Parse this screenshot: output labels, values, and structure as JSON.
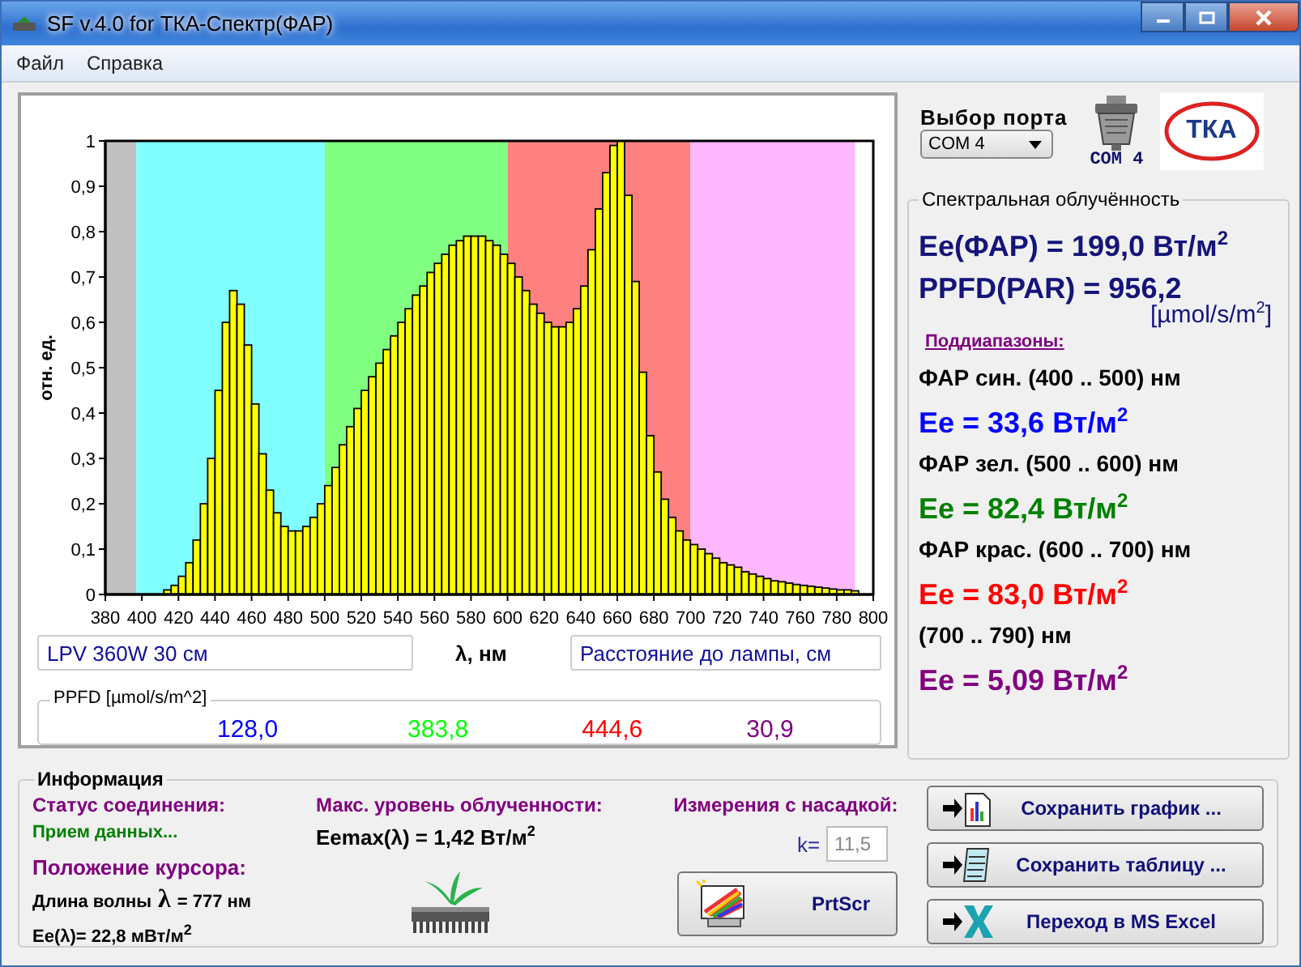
{
  "window": {
    "title": "SF v.4.0 for ТКА-Спектр(ФАР)"
  },
  "menu": [
    "Файл",
    "Справка"
  ],
  "chart": {
    "chart_data": {
      "type": "bar",
      "ylabel": "отн. ед.",
      "xlabel": "λ, нм",
      "x": [
        402,
        406,
        410,
        414,
        418,
        422,
        426,
        430,
        434,
        438,
        442,
        446,
        450,
        454,
        458,
        462,
        466,
        470,
        474,
        478,
        482,
        486,
        490,
        494,
        498,
        502,
        506,
        510,
        514,
        518,
        522,
        526,
        530,
        534,
        538,
        542,
        546,
        550,
        554,
        558,
        562,
        566,
        570,
        574,
        578,
        582,
        586,
        590,
        594,
        598,
        602,
        606,
        610,
        614,
        618,
        622,
        626,
        630,
        634,
        638,
        642,
        646,
        650,
        654,
        658,
        662,
        666,
        670,
        674,
        678,
        682,
        686,
        690,
        694,
        698,
        702,
        706,
        710,
        714,
        718,
        722,
        726,
        730,
        734,
        738,
        742,
        746,
        750,
        754,
        758,
        762,
        766,
        770,
        774,
        778,
        782,
        786,
        790
      ],
      "values": [
        0.0,
        0.0,
        0.0,
        0.01,
        0.02,
        0.04,
        0.07,
        0.12,
        0.2,
        0.3,
        0.45,
        0.6,
        0.67,
        0.64,
        0.55,
        0.42,
        0.31,
        0.23,
        0.18,
        0.15,
        0.14,
        0.14,
        0.15,
        0.17,
        0.2,
        0.24,
        0.28,
        0.33,
        0.37,
        0.41,
        0.45,
        0.48,
        0.51,
        0.54,
        0.57,
        0.6,
        0.63,
        0.66,
        0.68,
        0.71,
        0.73,
        0.75,
        0.77,
        0.78,
        0.79,
        0.79,
        0.79,
        0.78,
        0.77,
        0.75,
        0.73,
        0.7,
        0.67,
        0.64,
        0.62,
        0.6,
        0.59,
        0.59,
        0.6,
        0.63,
        0.68,
        0.76,
        0.85,
        0.93,
        0.99,
        1.0,
        0.88,
        0.69,
        0.49,
        0.35,
        0.27,
        0.21,
        0.17,
        0.14,
        0.12,
        0.11,
        0.1,
        0.09,
        0.08,
        0.07,
        0.065,
        0.06,
        0.05,
        0.045,
        0.04,
        0.035,
        0.03,
        0.028,
        0.025,
        0.022,
        0.02,
        0.018,
        0.016,
        0.014,
        0.012,
        0.01,
        0.01,
        0.008
      ],
      "xlim": [
        380,
        800
      ],
      "ylim": [
        0,
        1
      ],
      "xticks": [
        380,
        400,
        420,
        440,
        460,
        480,
        500,
        520,
        540,
        560,
        580,
        600,
        620,
        640,
        660,
        680,
        700,
        720,
        740,
        760,
        780,
        800
      ],
      "yticks": [
        0,
        {
          "value": 0.1,
          "label": "0,1"
        },
        {
          "value": 0.2,
          "label": "0,2"
        },
        {
          "value": 0.3,
          "label": "0,3"
        },
        {
          "value": 0.4,
          "label": "0,4"
        },
        {
          "value": 0.5,
          "label": "0,5"
        },
        {
          "value": 0.6,
          "label": "0,6"
        },
        {
          "value": 0.7,
          "label": "0,7"
        },
        {
          "value": 0.8,
          "label": "0,8"
        },
        {
          "value": 0.9,
          "label": "0,9"
        },
        1
      ],
      "bands": [
        {
          "axis": "x",
          "from": 380,
          "to": 397,
          "color": "#c0c0c0"
        },
        {
          "axis": "x",
          "from": 397,
          "to": 500,
          "color": "#80ffff"
        },
        {
          "axis": "x",
          "from": 500,
          "to": 600,
          "color": "#80ff80"
        },
        {
          "axis": "x",
          "from": 600,
          "to": 700,
          "color": "#ff8080"
        },
        {
          "axis": "x",
          "from": 700,
          "to": 790,
          "color": "#ffb8ff"
        }
      ]
    },
    "fields": [
      {
        "value": "LPV 360W 30 см"
      },
      {
        "value": "Расстояние до лампы,  см"
      }
    ],
    "ppfd": {
      "title": "PPFD [µmol/s/m^2]",
      "values": [
        {
          "text": "128,0",
          "color": "#0000ff"
        },
        {
          "text": "383,8",
          "color": "#00ff00"
        },
        {
          "text": "444,6",
          "color": "#ff0000"
        },
        {
          "text": "30,9",
          "color": "#800080"
        }
      ]
    }
  },
  "port": {
    "label": "Выбор порта",
    "selected": "COM 4",
    "status": "COM 4"
  },
  "logo": {
    "text": "ТКА"
  },
  "spectral": {
    "title": "Спектральная облучённость",
    "total": "Ee(ФАР) = 199,0 Вт/м$^{2}$",
    "ppfd": "PPFD(PAR) = 956,2",
    "ppfd_unit": "[µmol/s/m$^{2}$]",
    "subranges_title": "Поддиапазоны:",
    "bands": [
      {
        "label": "ФАР син. (400 .. 500) нм",
        "value": "Ee = 33,6 Вт/м$^{2}$",
        "color": "#0000ff"
      },
      {
        "label": "ФАР зел. (500 .. 600) нм",
        "value": "Ee = 82,4 Вт/м$^{2}$",
        "color": "#008000"
      },
      {
        "label": "ФАР крас. (600 .. 700) нм",
        "value": "Ee = 83,0 Вт/м$^{2}$",
        "color": "#ff0000"
      },
      {
        "label": "(700 .. 790) нм",
        "value": "Ee = 5,09 Вт/м$^{2}$",
        "color": "#800080"
      }
    ]
  },
  "info": {
    "title": "Информация",
    "status_label": "Статус соединения:",
    "status_value": "Прием данных...",
    "cursor_label": "Положение курсора:",
    "wavelength_label": "Длина волны",
    "wavelength_symbol": "λ",
    "wavelength_value": "= 777 нм",
    "cursor_ee": "Ee(λ)= 22,8 мВт/м$^{2}$",
    "max_label": "Макс. уровень облученности:",
    "max_value": "Eemax(λ) = 1,42 Вт/м$^{2}$",
    "nozzle_label": "Измерения с насадкой:",
    "k_label": "k=",
    "k_value": "11,5",
    "prtscr": "PrtScr"
  },
  "buttons": [
    {
      "label": "Сохранить график ...",
      "kind": "chart"
    },
    {
      "label": "Сохранить таблицу ...",
      "kind": "table"
    },
    {
      "label": "Переход в MS Excel",
      "kind": "excel"
    }
  ]
}
